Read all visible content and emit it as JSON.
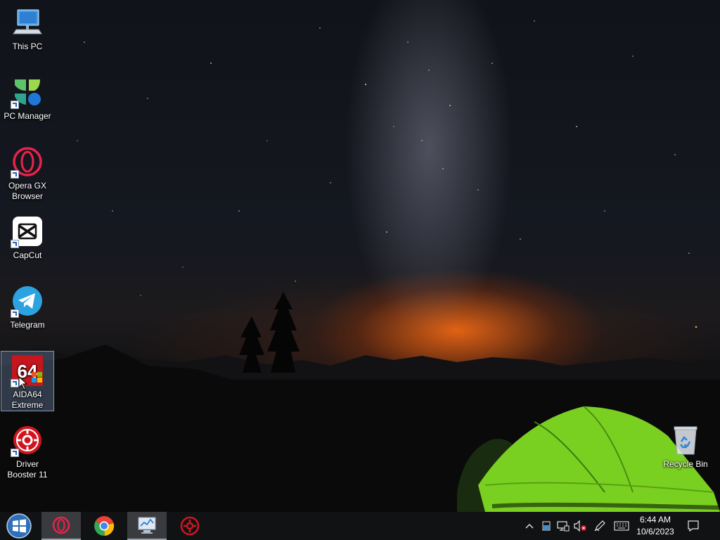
{
  "desktop": {
    "icons": [
      {
        "label": "This PC",
        "icon": "this-pc-icon"
      },
      {
        "label": "PC Manager",
        "icon": "pc-manager-icon"
      },
      {
        "label": "Opera GX Browser",
        "icon": "opera-gx-icon"
      },
      {
        "label": "CapCut",
        "icon": "capcut-icon"
      },
      {
        "label": "Telegram",
        "icon": "telegram-icon"
      },
      {
        "label": "AIDA64 Extreme",
        "icon": "aida64-icon",
        "selected": true
      },
      {
        "label": "Driver Booster 11",
        "icon": "driver-booster-icon"
      },
      {
        "label": "Recycle Bin",
        "icon": "recycle-bin-icon"
      }
    ],
    "aida_badge": "64"
  },
  "taskbar": {
    "start": {
      "icon": "windows-start-icon"
    },
    "apps": [
      {
        "name": "Opera GX",
        "icon": "opera-gx-icon",
        "active": true
      },
      {
        "name": "Google Chrome",
        "icon": "chrome-icon",
        "active": false
      },
      {
        "name": "Task Manager",
        "icon": "monitor-app-icon",
        "active": true
      },
      {
        "name": "Driver Booster",
        "icon": "driver-booster-icon",
        "active": false
      }
    ],
    "tray": {
      "icons": [
        "chevron-up-icon",
        "storage-icon",
        "network-icon",
        "volume-muted-icon",
        "pen-icon",
        "keyboard-icon",
        "notification-icon"
      ]
    },
    "clock": {
      "time": "6:44 AM",
      "date": "10/6/2023"
    }
  }
}
